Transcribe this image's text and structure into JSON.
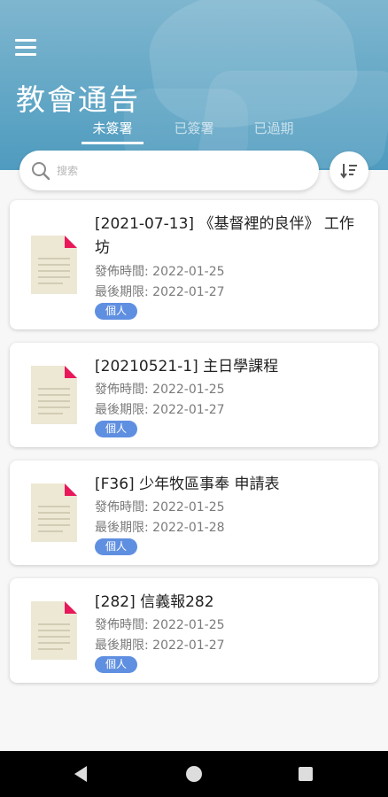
{
  "header": {
    "title": "教會通告",
    "tabs": [
      {
        "label": "未簽署"
      },
      {
        "label": "已簽署"
      },
      {
        "label": "已過期"
      }
    ]
  },
  "search": {
    "placeholder": "搜索",
    "icon": "search-icon"
  },
  "sort": {
    "icon": "sort-icon"
  },
  "colors": {
    "header": "#63a7c6",
    "badge": "#5f8fe0",
    "doc_fold": "#e8185a",
    "doc_paper": "#ede8d3"
  },
  "notices": [
    {
      "title": "[2021-07-13] 《基督裡的良伴》 工作坊",
      "publish_label": "發佈時間:",
      "publish_date": "2022-01-25",
      "deadline_label": "最後期限:",
      "deadline_date": "2022-01-27",
      "badge": "個人"
    },
    {
      "title": "[20210521-1] 主日學課程",
      "publish_label": "發佈時間:",
      "publish_date": "2022-01-25",
      "deadline_label": "最後期限:",
      "deadline_date": "2022-01-27",
      "badge": "個人"
    },
    {
      "title": "[F36] 少年牧區事奉 申請表",
      "publish_label": "發佈時間:",
      "publish_date": "2022-01-25",
      "deadline_label": "最後期限:",
      "deadline_date": "2022-01-28",
      "badge": "個人"
    },
    {
      "title": "[282] 信義報282",
      "publish_label": "發佈時間:",
      "publish_date": "2022-01-25",
      "deadline_label": "最後期限:",
      "deadline_date": "2022-01-27",
      "badge": "個人"
    }
  ]
}
